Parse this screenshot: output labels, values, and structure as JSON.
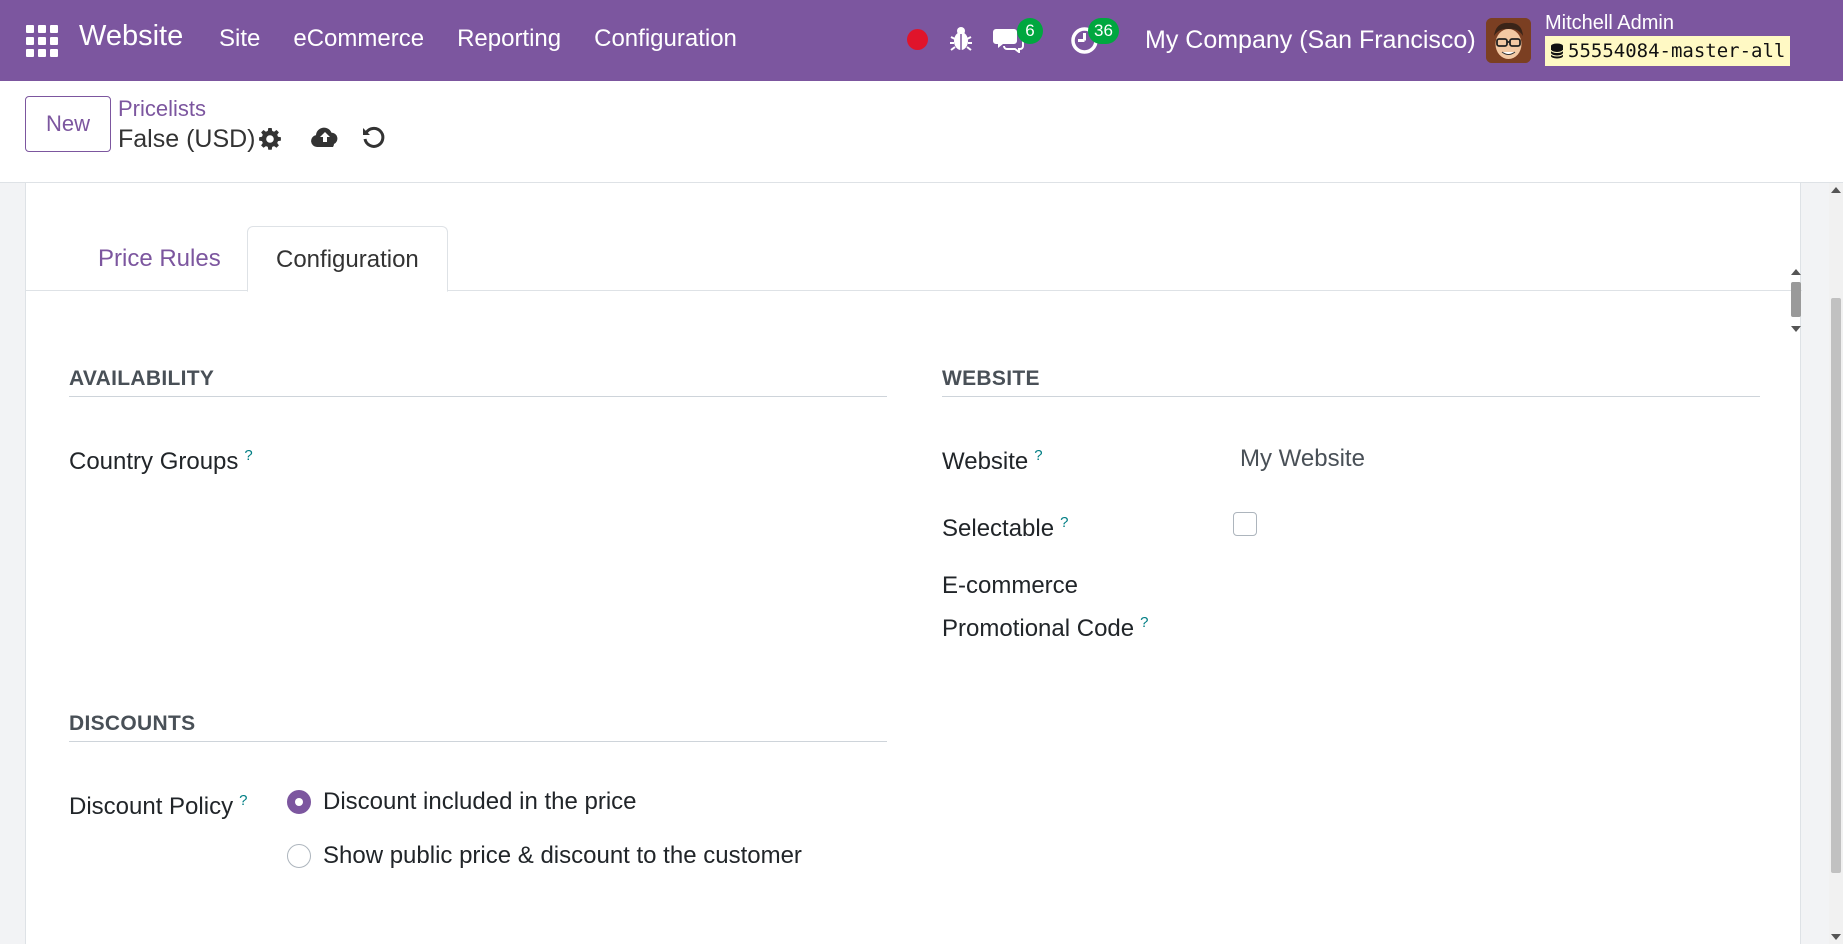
{
  "navbar": {
    "brand": "Website",
    "menu": [
      "Site",
      "eCommerce",
      "Reporting",
      "Configuration"
    ],
    "chat_count": "6",
    "activity_count": "36",
    "company": "My Company (San Francisco)",
    "user_name": "Mitchell Admin",
    "database": "55554084-master-all",
    "bg_color": "#7c569f",
    "badge_color": "#00a73f",
    "record_dot_color": "#e0142b"
  },
  "control_panel": {
    "new_button": "New",
    "breadcrumb": "Pricelists",
    "record_title": "False (USD)"
  },
  "tabs": [
    {
      "label": "Price Rules",
      "active": false
    },
    {
      "label": "Configuration",
      "active": true
    }
  ],
  "availability": {
    "title": "AVAILABILITY",
    "country_groups_label": "Country Groups",
    "help_mark": "?"
  },
  "website_section": {
    "title": "WEBSITE",
    "website_label": "Website",
    "website_value": "My Website",
    "selectable_label": "Selectable",
    "selectable_checked": false,
    "promo_label_line1": "E-commerce",
    "promo_label_line2": "Promotional Code"
  },
  "discounts": {
    "title": "DISCOUNTS",
    "policy_label": "Discount Policy",
    "options": [
      {
        "label": "Discount included in the price",
        "checked": true
      },
      {
        "label": "Show public price & discount to the customer",
        "checked": false
      }
    ]
  }
}
